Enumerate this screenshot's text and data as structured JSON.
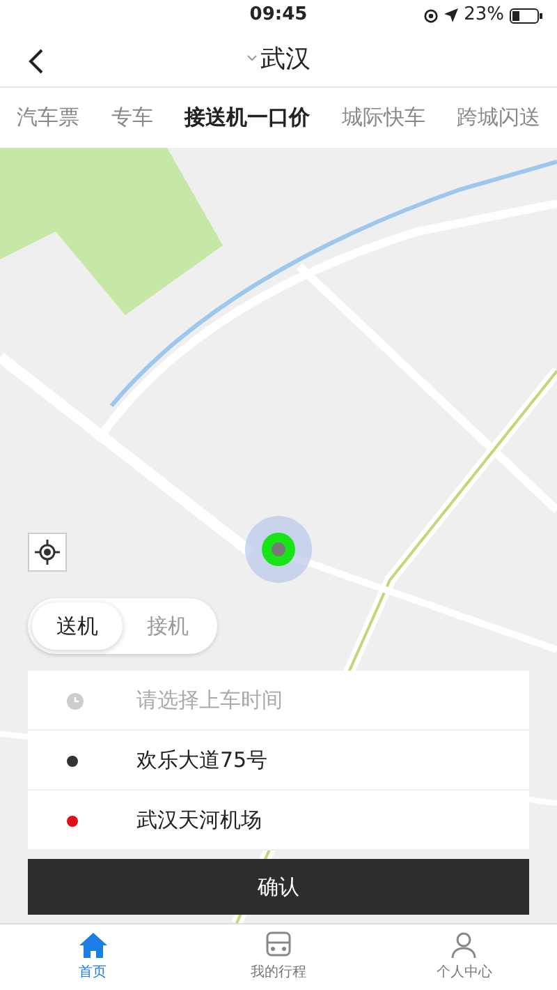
{
  "status_bar": {
    "time": "09:45",
    "battery": "23%"
  },
  "nav": {
    "title": "武汉"
  },
  "tabs": [
    {
      "label": "汽车票",
      "selected": false
    },
    {
      "label": "专车",
      "selected": false
    },
    {
      "label": "接送机一口价",
      "selected": true
    },
    {
      "label": "城际快车",
      "selected": false
    },
    {
      "label": "跨城闪送",
      "selected": false
    }
  ],
  "trip_toggle": [
    {
      "label": "送机",
      "selected": true
    },
    {
      "label": "接机",
      "selected": false
    }
  ],
  "form": {
    "time_placeholder": "请选择上车时间",
    "route": [
      {
        "text": "欢乐大道75号",
        "color": "#333333"
      },
      {
        "text": "武汉天河机场",
        "color": "#e0101a"
      }
    ]
  },
  "confirm": "确认",
  "bottom_tabs": [
    {
      "label": "首页",
      "kind": "home",
      "selected": true
    },
    {
      "label": "我的行程",
      "kind": "bus",
      "selected": false
    },
    {
      "label": "个人中心",
      "kind": "person",
      "selected": false
    }
  ]
}
